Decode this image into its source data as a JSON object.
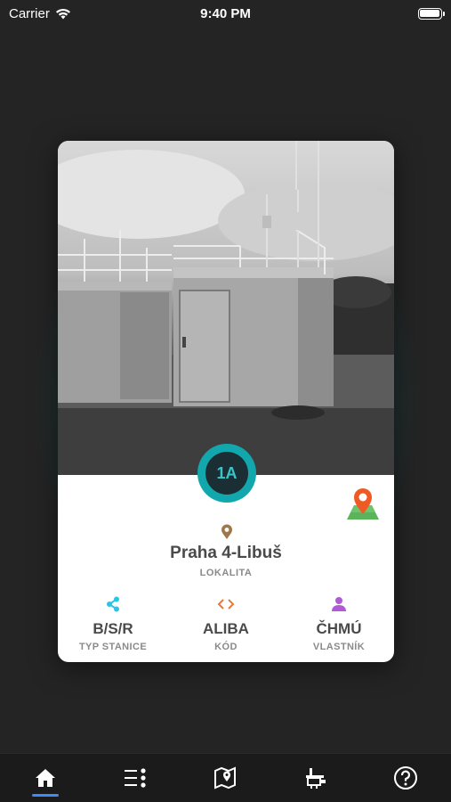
{
  "status": {
    "carrier": "Carrier",
    "time": "9:40 PM"
  },
  "station": {
    "code": "1A",
    "location_name": "Praha 4-Libuš",
    "location_caption": "LOKALITA",
    "type_value": "B/S/R",
    "type_caption": "TYP STANICE",
    "code_value": "ALIBA",
    "code_caption": "KÓD",
    "owner_value": "ČHMÚ",
    "owner_caption": "VLASTNÍK"
  },
  "colors": {
    "accent": "#12a7ad",
    "share": "#29c5e6",
    "code": "#e8773a",
    "owner": "#b05ad8",
    "location": "#a0764b",
    "tab_active": "#3d8bf5"
  },
  "icons": {
    "type": "share-icon",
    "code": "code-icon",
    "owner": "person-icon",
    "location": "location-pin-icon",
    "map": "map-pin-icon"
  },
  "tabs": [
    {
      "name": "home",
      "icon": "home-icon",
      "active": true
    },
    {
      "name": "list",
      "icon": "list-icon",
      "active": false
    },
    {
      "name": "map",
      "icon": "map-icon",
      "active": false
    },
    {
      "name": "stations",
      "icon": "station-icon",
      "active": false
    },
    {
      "name": "help",
      "icon": "help-icon",
      "active": false
    }
  ]
}
